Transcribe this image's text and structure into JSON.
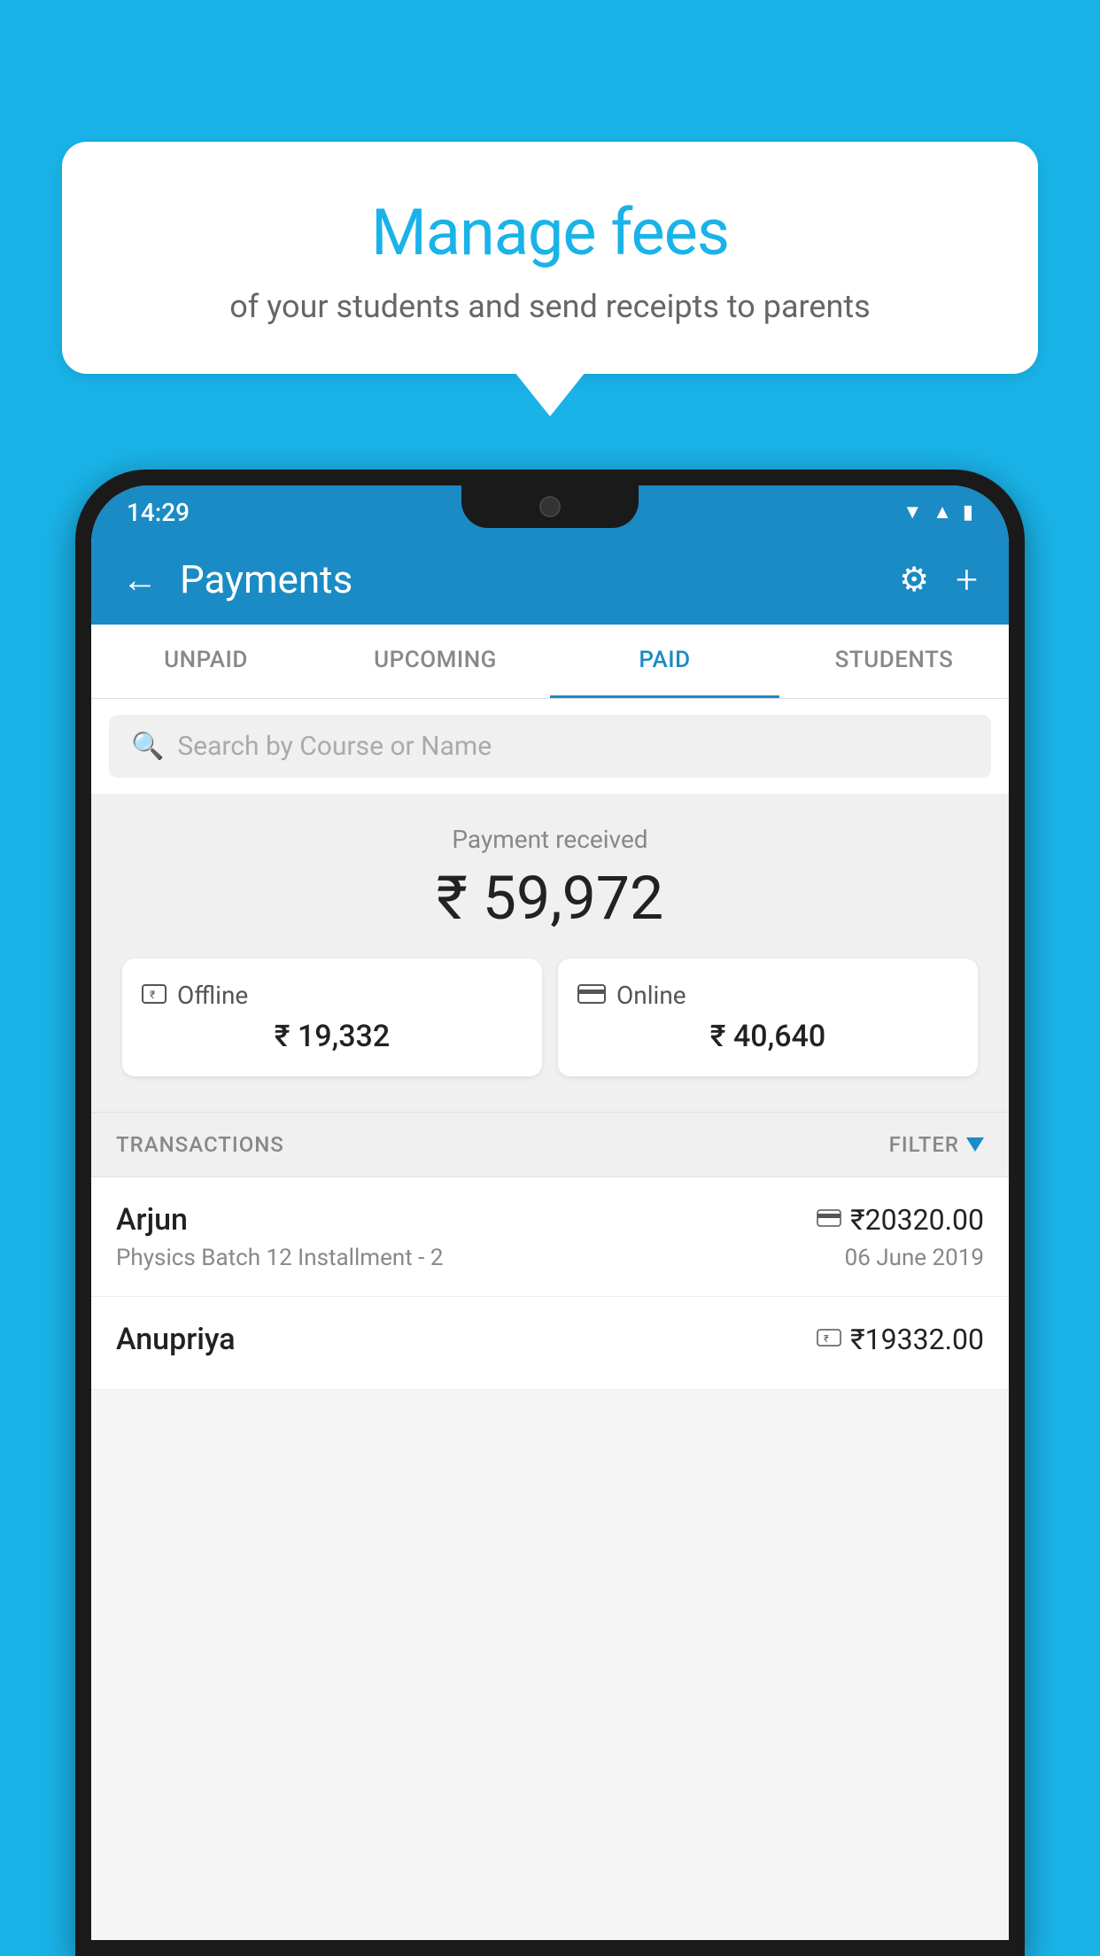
{
  "background_color": "#1ab3e8",
  "speech_bubble": {
    "title": "Manage fees",
    "subtitle": "of your students and send receipts to parents"
  },
  "status_bar": {
    "time": "14:29",
    "wifi_symbol": "▼",
    "signal_symbol": "▲",
    "battery_symbol": "▮"
  },
  "header": {
    "back_arrow": "←",
    "title": "Payments",
    "gear_icon": "⚙",
    "plus_icon": "+"
  },
  "tabs": [
    {
      "label": "UNPAID",
      "active": false
    },
    {
      "label": "UPCOMING",
      "active": false
    },
    {
      "label": "PAID",
      "active": true
    },
    {
      "label": "STUDENTS",
      "active": false
    }
  ],
  "search": {
    "placeholder": "Search by Course or Name",
    "icon": "🔍"
  },
  "payment_summary": {
    "label": "Payment received",
    "amount": "₹ 59,972",
    "offline": {
      "icon": "💳",
      "label": "Offline",
      "amount": "₹ 19,332"
    },
    "online": {
      "icon": "💳",
      "label": "Online",
      "amount": "₹ 40,640"
    }
  },
  "transactions_section": {
    "label": "TRANSACTIONS",
    "filter_label": "FILTER"
  },
  "transactions": [
    {
      "name": "Arjun",
      "amount": "₹20320.00",
      "course": "Physics Batch 12 Installment - 2",
      "date": "06 June 2019",
      "payment_type": "online"
    },
    {
      "name": "Anupriya",
      "amount": "₹19332.00",
      "course": "",
      "date": "",
      "payment_type": "offline"
    }
  ]
}
